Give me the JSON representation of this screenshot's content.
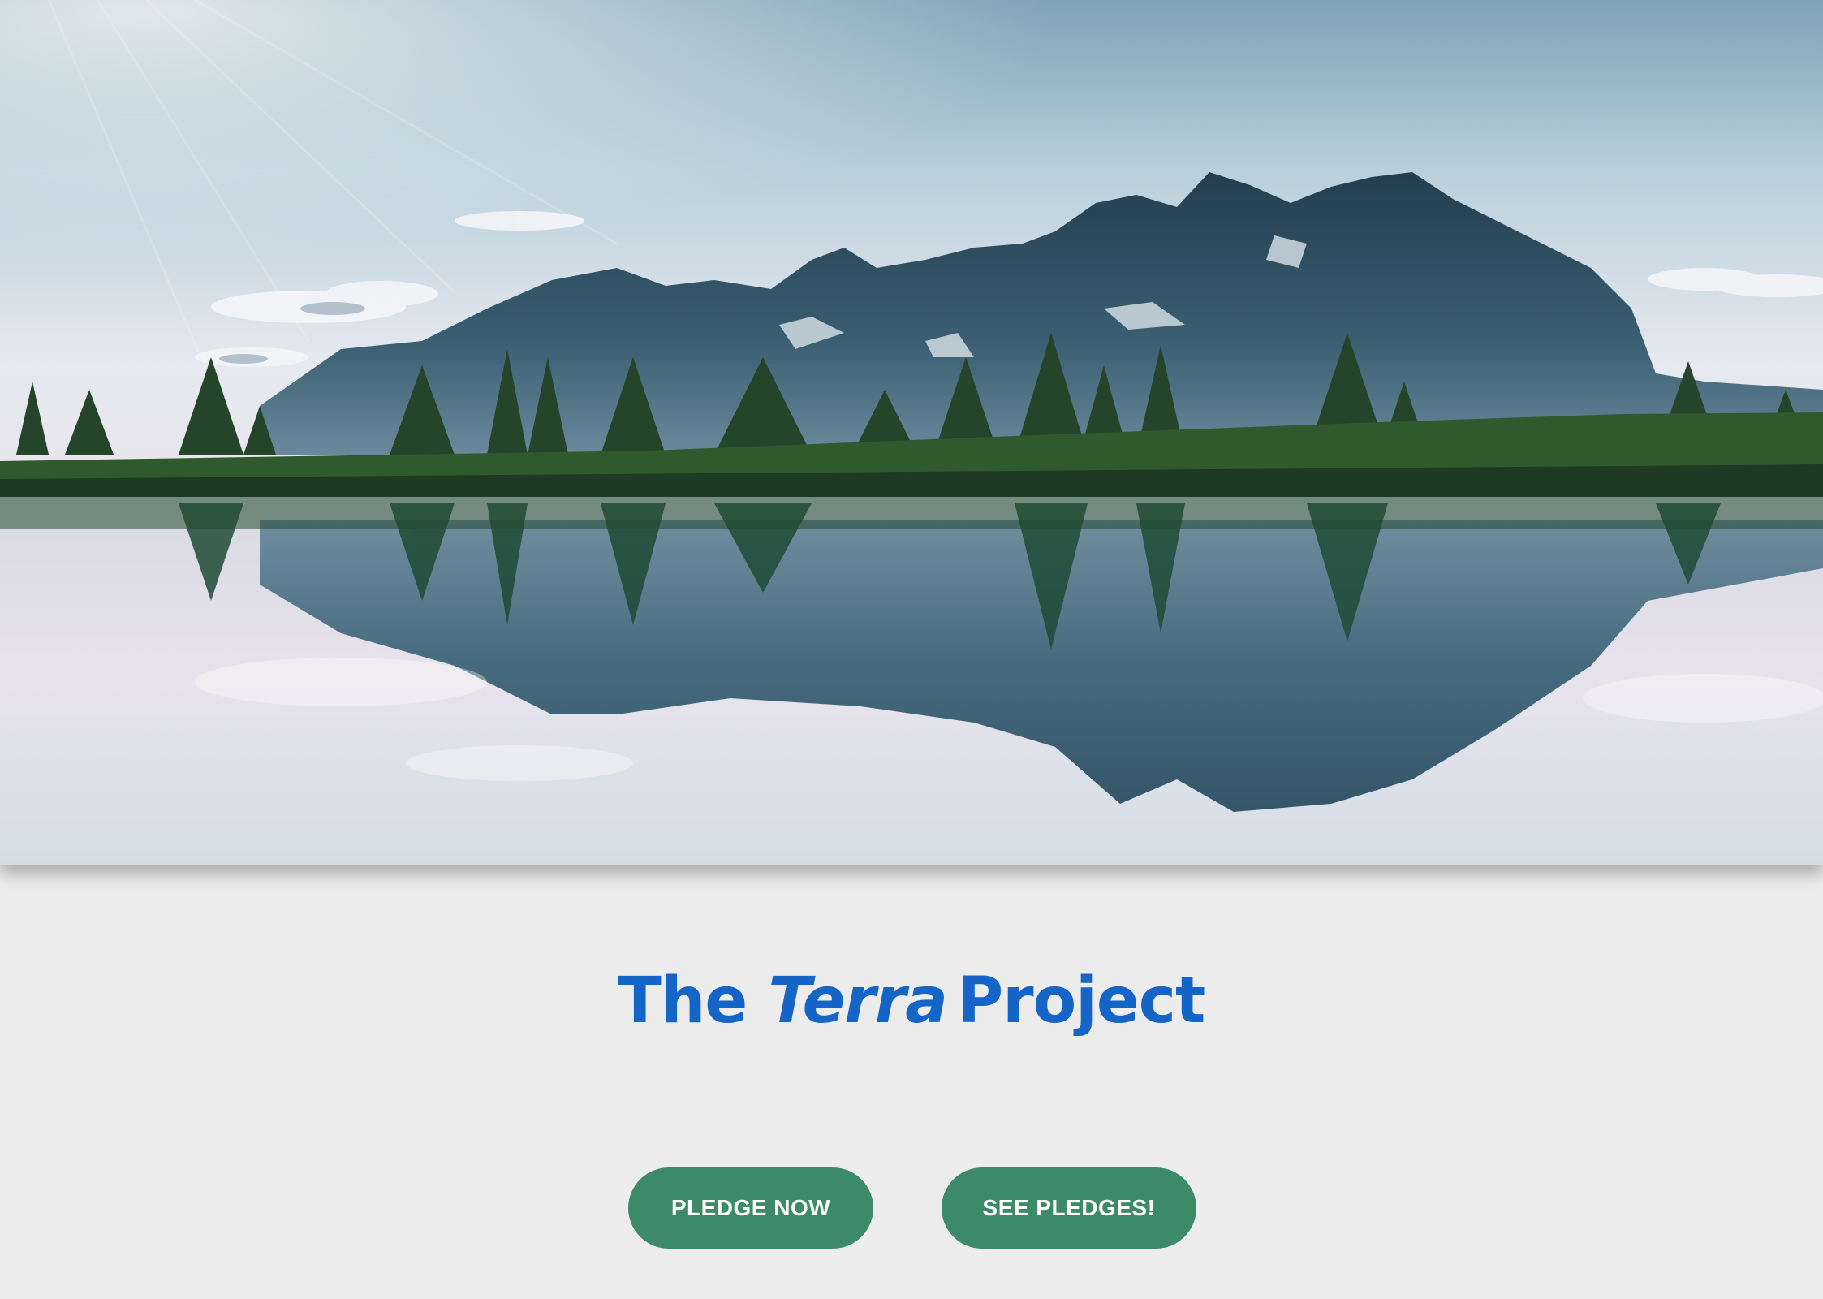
{
  "hero": {
    "image_label": "mountain-lake-landscape"
  },
  "title": {
    "prefix": "The",
    "emphasis": "Terra",
    "suffix": "Project",
    "color": "#1565c8"
  },
  "actions": {
    "pledge_now_label": "PLEDGE NOW",
    "see_pledges_label": "SEE PLEDGES!",
    "button_color": "#3c8a6a"
  },
  "theme": {
    "background": "#ececec"
  }
}
